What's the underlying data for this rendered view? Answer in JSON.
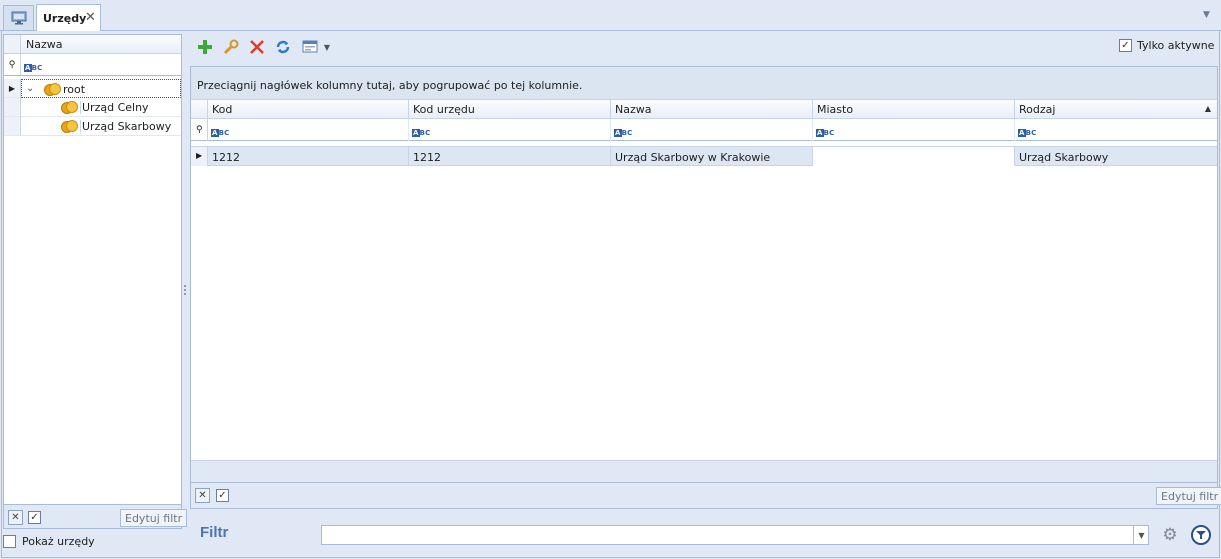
{
  "tabs": [
    {
      "icon": "monitor-icon"
    },
    {
      "label": "Urzędy",
      "close": "✕"
    }
  ],
  "left_panel": {
    "column_header": "Nazwa",
    "tree": [
      {
        "label": "root",
        "icon": "coins-icon",
        "expanded": true
      },
      {
        "label": "Urząd Celny",
        "icon": "coins-icon"
      },
      {
        "label": "Urząd Skarbowy",
        "icon": "coins-icon"
      }
    ],
    "edit_filter_label": "Edytuj filtr",
    "show_offices_label": "Pokaż urzędy"
  },
  "toolbar": {
    "icons": [
      "add-icon",
      "wrench-icon",
      "delete-icon",
      "refresh-icon",
      "export-icon"
    ],
    "only_active_label": "Tylko aktywne",
    "only_active_checked": true
  },
  "grid": {
    "group_panel_text": "Przeciągnij nagłówek kolumny tutaj, aby pogrupować po tej kolumnie.",
    "columns": [
      "Kod",
      "Kod urzędu",
      "Nazwa",
      "Miasto",
      "Rodzaj"
    ],
    "rows": [
      [
        "1212",
        "1212",
        "Urząd Skarbowy w Krakowie",
        "",
        "Urząd Skarbowy"
      ]
    ],
    "edit_filter_label": "Edytuj filtr"
  },
  "filter_bar": {
    "label": "Filtr",
    "value": ""
  },
  "colors": {
    "background": "#dfe8f4",
    "border": "#a9bcd6",
    "filter_label": "#4d74b3",
    "selected_row": "#dde7f3"
  }
}
